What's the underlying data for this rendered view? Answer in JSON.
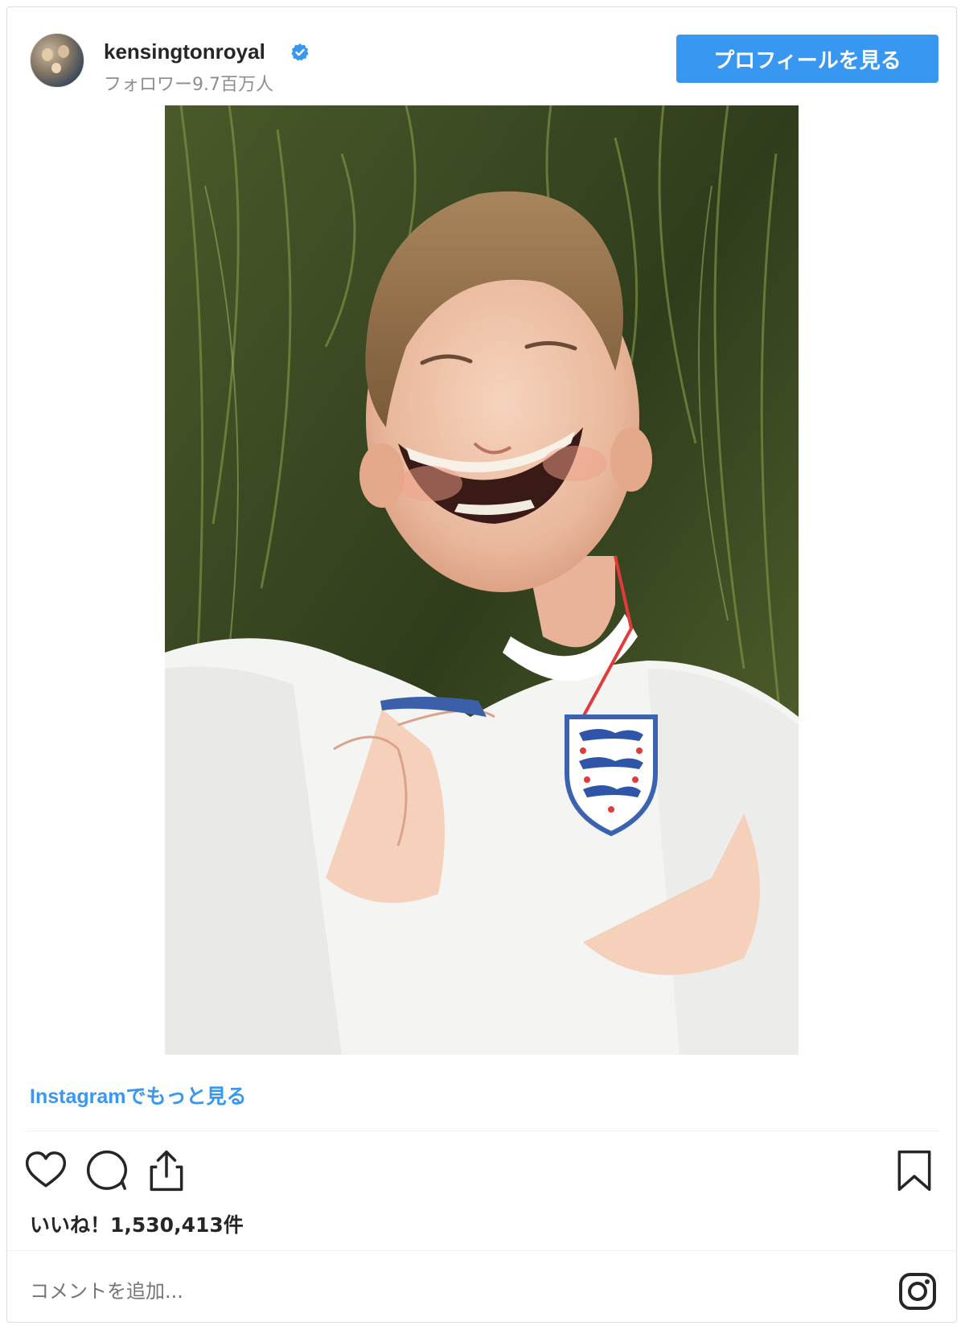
{
  "post": {
    "username": "kensingtonroyal",
    "followers": "フォロワー9.7百万人",
    "profile_button": "プロフィールを見る",
    "more_link": "Instagramでもっと見る",
    "likes": "いいね！1,530,413件",
    "comment_placeholder": "コメントを追加...",
    "verified": true
  },
  "icons": {
    "like": "heart-icon",
    "comment": "comment-icon",
    "share": "share-icon",
    "save": "bookmark-icon",
    "instagram": "instagram-logo-icon",
    "verified": "verified-badge-icon"
  },
  "colors": {
    "accent": "#3897f0",
    "text": "#262626",
    "secondary": "#8e8e8e",
    "border": "#dbdbdb"
  }
}
